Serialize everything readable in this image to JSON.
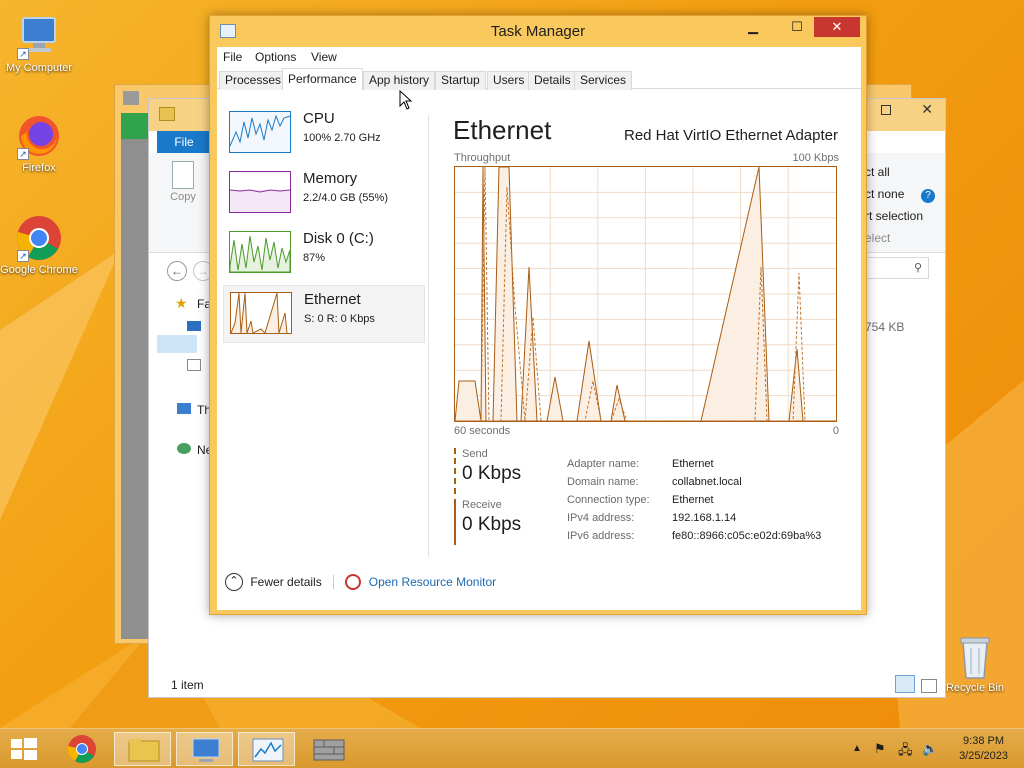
{
  "desktop": {
    "icons": [
      {
        "label": "My Computer",
        "icon": "computer-icon"
      },
      {
        "label": "Firefox",
        "icon": "firefox-icon"
      },
      {
        "label": "Google Chrome",
        "icon": "chrome-icon"
      },
      {
        "label": "Recycle Bin",
        "icon": "recycle-bin-icon"
      }
    ]
  },
  "explorer": {
    "file_tab": "File",
    "copy_label": "Copy",
    "select_all": "ct all",
    "select_none": "ct none",
    "invert_selection": "rt selection",
    "select_group": "elect",
    "nav_favorites": "Fa",
    "nav_this_pc": "Th",
    "nav_network": "Ne",
    "file_size": "754 KB",
    "status_items": "1 item"
  },
  "task_manager": {
    "title": "Task Manager",
    "menu": [
      "File",
      "Options",
      "View"
    ],
    "tabs": [
      "Processes",
      "Performance",
      "App history",
      "Startup",
      "Users",
      "Details",
      "Services"
    ],
    "active_tab": "Performance",
    "resources": [
      {
        "name": "CPU",
        "sub": "100% 2.70 GHz",
        "color": "#1b7bc4"
      },
      {
        "name": "Memory",
        "sub": "2.2/4.0 GB (55%)",
        "color": "#8b2b9d"
      },
      {
        "name": "Disk 0 (C:)",
        "sub": "87%",
        "color": "#4c9a2a"
      },
      {
        "name": "Ethernet",
        "sub": "S: 0 R: 0 Kbps",
        "color": "#a85d12"
      }
    ],
    "detail": {
      "title": "Ethernet",
      "adapter": "Red Hat VirtIO Ethernet Adapter",
      "graph_title": "Throughput",
      "graph_max": "100 Kbps",
      "graph_time": "60 seconds",
      "graph_min": "0",
      "send_label": "Send",
      "send_value": "0 Kbps",
      "receive_label": "Receive",
      "receive_value": "0 Kbps",
      "properties": [
        {
          "key": "Adapter name:",
          "value": "Ethernet"
        },
        {
          "key": "Domain name:",
          "value": "collabnet.local"
        },
        {
          "key": "Connection type:",
          "value": "Ethernet"
        },
        {
          "key": "IPv4 address:",
          "value": "192.168.1.14"
        },
        {
          "key": "IPv6 address:",
          "value": "fe80::8966:c05c:e02d:69ba%3"
        }
      ]
    },
    "footer": {
      "fewer_details": "Fewer details",
      "resource_monitor": "Open Resource Monitor"
    }
  },
  "taskbar": {
    "time": "9:38 PM",
    "date": "3/25/2023"
  }
}
